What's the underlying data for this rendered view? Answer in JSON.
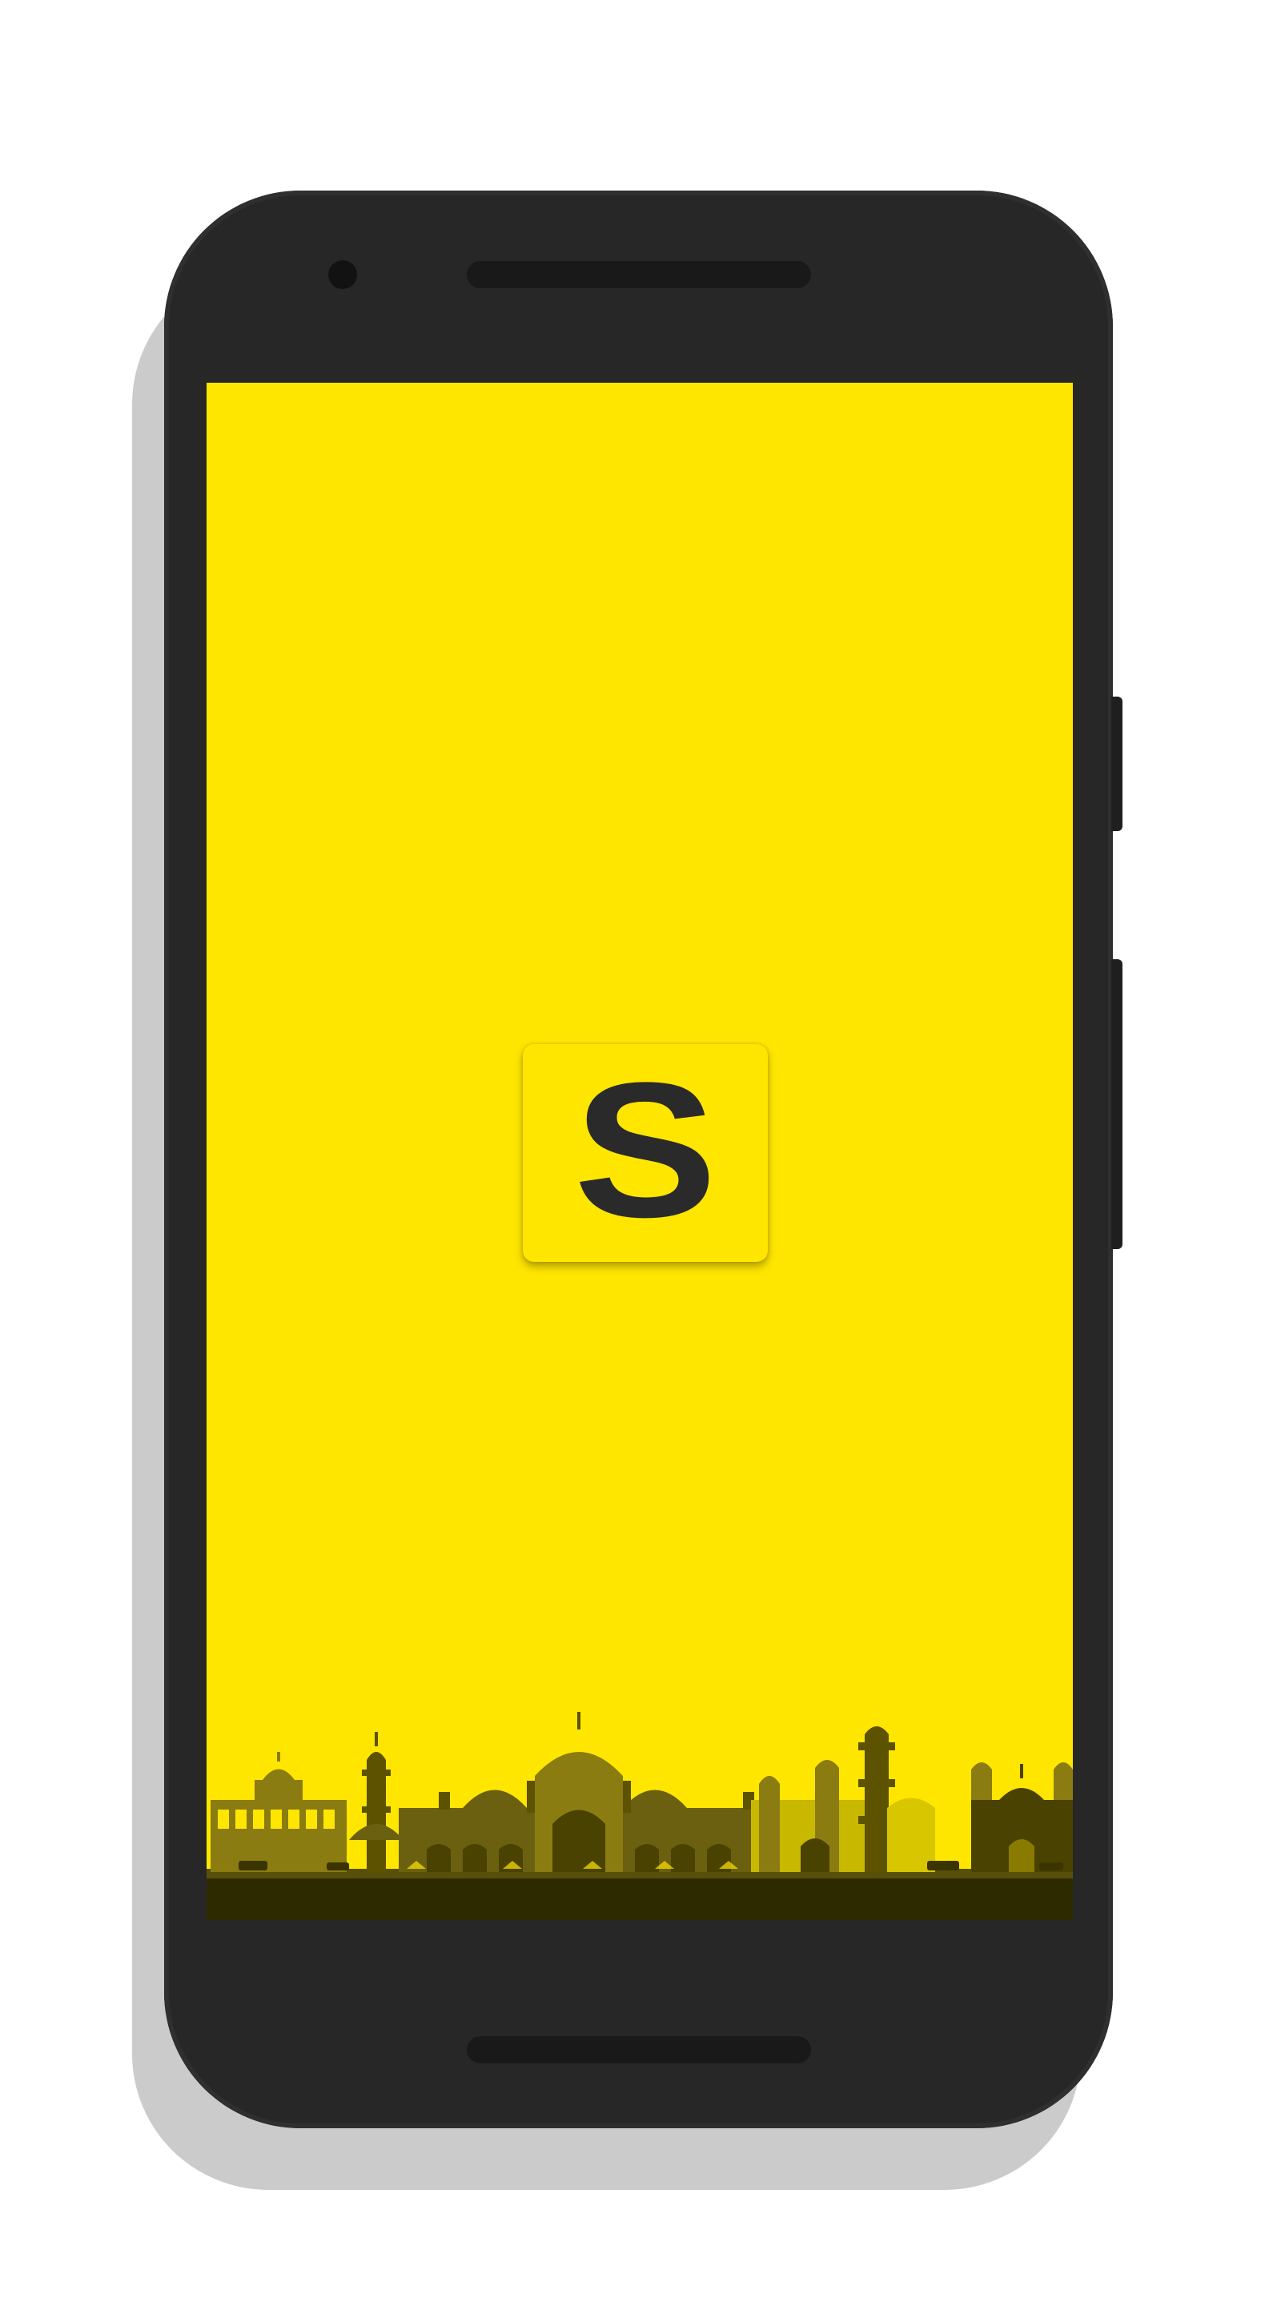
{
  "device": {
    "model": "android-phone",
    "colors": {
      "body": "#272727",
      "shadow": "#cbcbcb",
      "screen_background": "#ffe600"
    }
  },
  "splash": {
    "logo_letter": "S",
    "logo_color": "#2a2a2a",
    "background_color": "#ffe600",
    "illustration": "city-skyline-mosque-illustration"
  }
}
